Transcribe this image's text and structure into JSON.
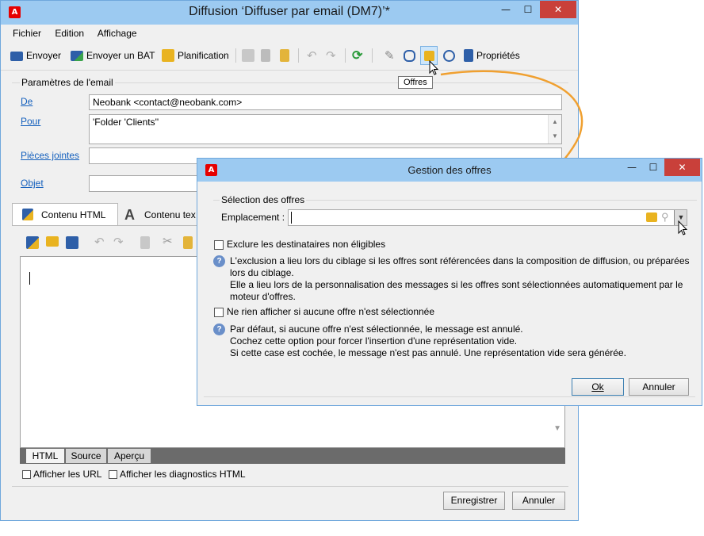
{
  "main_window": {
    "title": "Diffusion ‘Diffuser par email (DM7)’*",
    "app_icon_glyph": "A",
    "controls": {
      "minimize": "—",
      "maximize": "☐",
      "close": "✕"
    },
    "menu": [
      "Fichier",
      "Edition",
      "Affichage"
    ],
    "toolbar": {
      "send": "Envoyer",
      "send_proof": "Envoyer un BAT",
      "schedule": "Planification",
      "properties": "Propriétés"
    },
    "tooltip": "Offres",
    "email_params": {
      "section_title": "Paramètres de l'email",
      "from_label": "De",
      "from_value": "Neobank <contact@neobank.com>",
      "to_label": "Pour",
      "to_value": "'Folder 'Clients''",
      "attachments_label": "Pièces jointes",
      "subject_label": "Objet"
    },
    "content_tabs": [
      "Contenu HTML",
      "Contenu tex"
    ],
    "editor_tabs": [
      "HTML",
      "Source",
      "Aperçu"
    ],
    "checkboxes": {
      "show_urls": "Afficher les URL",
      "show_diag": "Afficher les diagnostics HTML"
    },
    "buttons": {
      "save": "Enregistrer",
      "cancel": "Annuler"
    }
  },
  "offers_dialog": {
    "title": "Gestion des offres",
    "group_title": "Sélection des offres",
    "location_label": "Emplacement :",
    "location_value": "",
    "exclude_label": "Exclure les destinataires non éligibles",
    "exclude_help": [
      "L'exclusion a lieu lors du ciblage si les offres sont référencées dans la composition de diffusion, ou préparées",
      "lors du ciblage.",
      "Elle a lieu lors de la personnalisation des messages si les offres sont sélectionnées automatiquement par le",
      "moteur d'offres."
    ],
    "noshow_label": "Ne rien afficher si aucune offre n'est sélectionnée",
    "noshow_help": [
      "Par défaut, si aucune offre n'est sélectionnée, le message est annulé.",
      "Cochez cette option pour forcer l'insertion d'une représentation vide.",
      "Si cette case est cochée, le message n'est pas annulé. Une représentation vide sera générée."
    ],
    "ok": "Ok",
    "cancel": "Annuler"
  },
  "colors": {
    "title_bar": "#9ccaf1",
    "close": "#c9403a",
    "link": "#1560bd",
    "callout_arrow": "#f0a030"
  }
}
